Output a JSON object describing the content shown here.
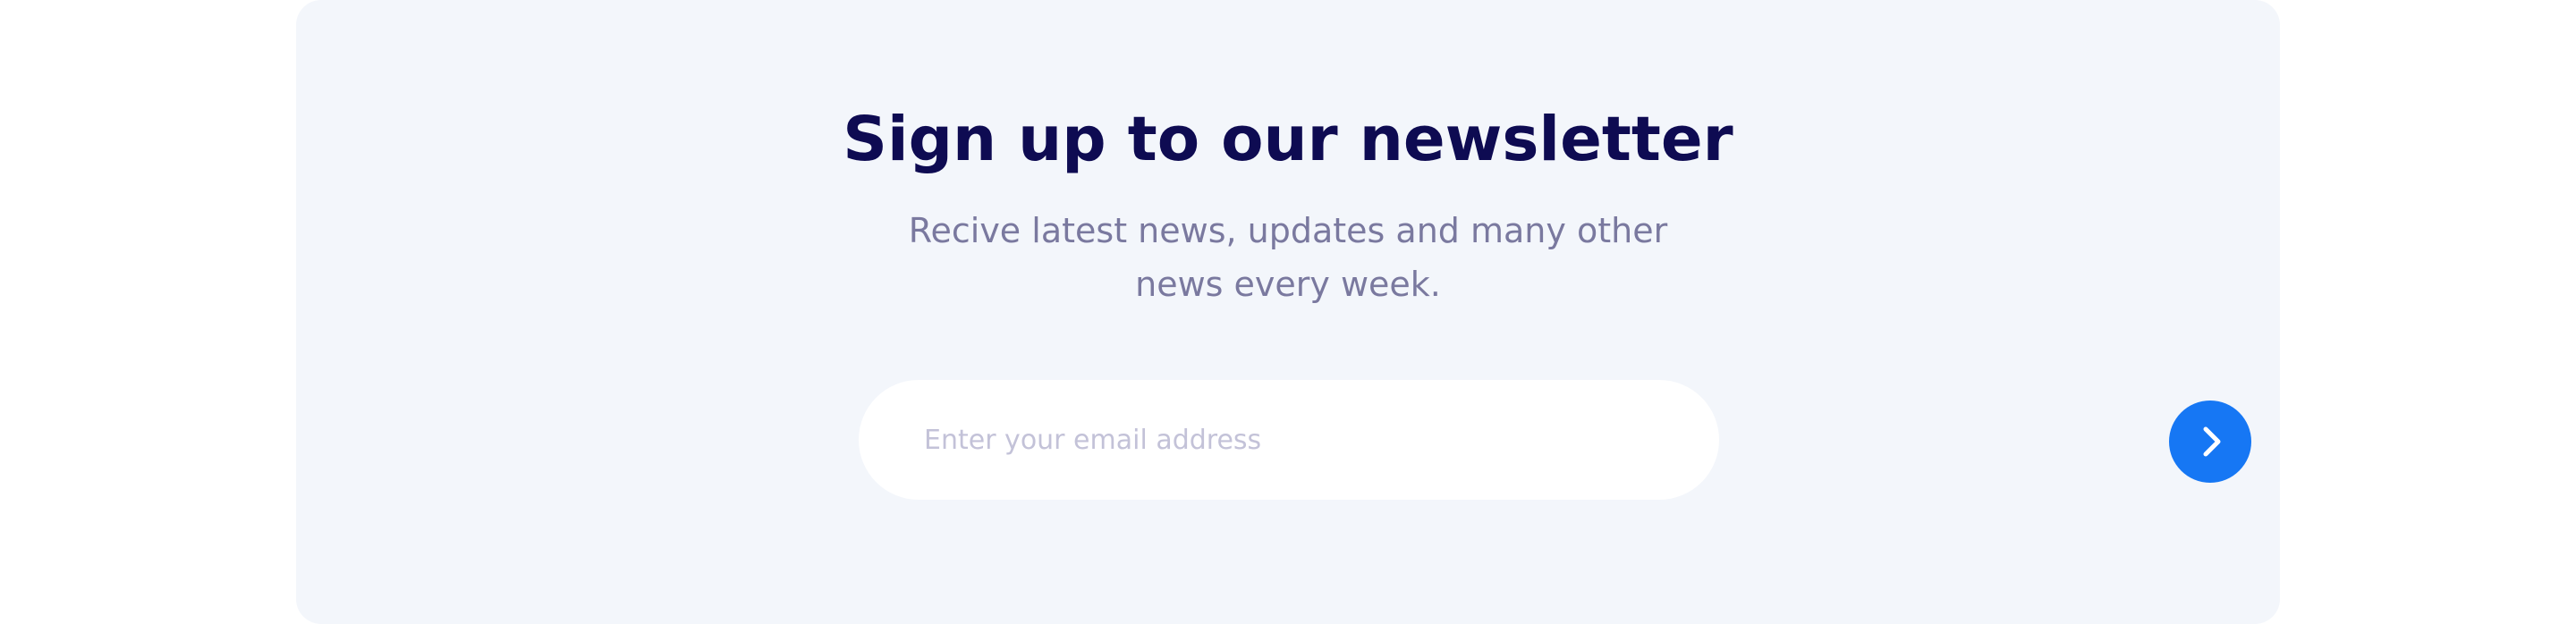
{
  "newsletter": {
    "title": "Sign up to our newsletter",
    "subtitle_line1": "Recive latest news, updates and many other",
    "subtitle_line2": "news every week.",
    "email_placeholder": "Enter your email address",
    "email_value": "",
    "submit_icon": "chevron-right-icon"
  },
  "colors": {
    "card_background": "#f3f6fb",
    "title": "#0e0b52",
    "subtitle": "#7a799f",
    "accent": "#1677f4",
    "placeholder": "#c3c2d8"
  }
}
